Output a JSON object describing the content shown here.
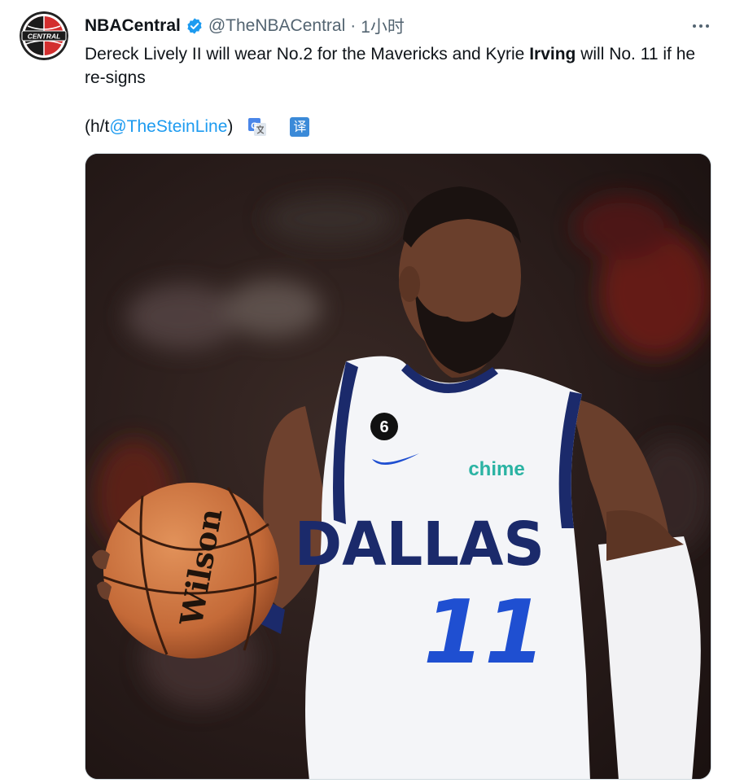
{
  "author": {
    "name": "NBACentral",
    "handle": "@TheNBACentral",
    "separator": "·",
    "time": "1小时",
    "avatar_text": "CENTRAL"
  },
  "tweet": {
    "text_part1": "Dereck Lively II will wear No.2 for the Mavericks and Kyrie ",
    "text_bold": "Irving",
    "text_part2": " will No. 11 if he re-signs",
    "credit_prefix": "(h/t ",
    "credit_link": "@TheSteinLine",
    "credit_suffix": " )",
    "translate_label": "译"
  },
  "media": {
    "jersey_team": "DALLAS",
    "jersey_number": "11",
    "sponsor": "chime",
    "patch_number": "6",
    "ball_brand": "Wilson"
  },
  "colors": {
    "link": "#1d9bf0",
    "verified": "#1d9bf0",
    "jersey_navy": "#1b2a6b",
    "jersey_blue": "#1f4fd1",
    "sponsor": "#2bb3a3"
  },
  "icons": [
    "verified-icon",
    "more-icon",
    "google-translate-icon",
    "translate-icon"
  ]
}
